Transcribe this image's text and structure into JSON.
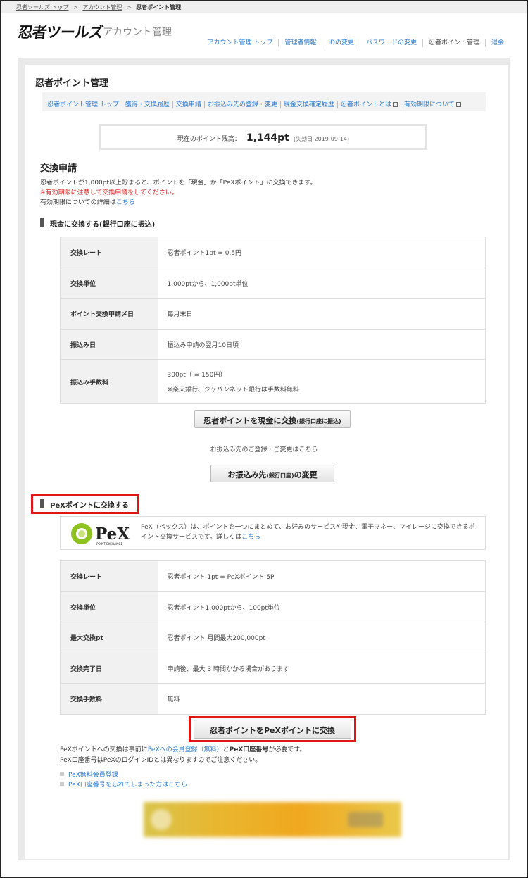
{
  "breadcrumb": {
    "items": [
      "忍者ツールズ トップ",
      "アカウント管理",
      "忍者ポイント管理"
    ],
    "separator": ">"
  },
  "header": {
    "logo": "忍者ツールズ",
    "subtitle": "アカウント管理",
    "nav": [
      "アカウント管理 トップ",
      "管理者情報",
      "IDの変更",
      "パスワードの変更",
      "忍者ポイント管理",
      "退会"
    ]
  },
  "page": {
    "title": "忍者ポイント管理",
    "subnav": [
      "忍者ポイント管理 トップ",
      "獲得・交換履歴",
      "交換申請",
      "お振込み先の登録・変更",
      "現金交換確定履歴",
      "忍者ポイントとは",
      "有効期限について"
    ]
  },
  "balance": {
    "label": "現在のポイント残高：",
    "value": "1,144pt",
    "expiry": "(失効日 2019-09-14)"
  },
  "exchange": {
    "title": "交換申請",
    "desc1": "忍者ポイントが1,000pt以上貯まると、ポイントを「現金」か「PeXポイント」に交換できます。",
    "warning": "※有効期限に注意して交換申請をしてください。",
    "desc3_prefix": "有効期限についての詳細は",
    "desc3_link": "こちら"
  },
  "cash": {
    "heading": "現金に交換する(銀行口座に振込)",
    "rows": [
      {
        "label": "交換レート",
        "value": "忍者ポイント1pt = 0.5円"
      },
      {
        "label": "交換単位",
        "value": "1,000ptから、1,000pt単位"
      },
      {
        "label": "ポイント交換申請〆日",
        "value": "毎月末日"
      },
      {
        "label": "振込み日",
        "value": "振込み申請の翌月10日頃"
      },
      {
        "label": "振込み手数料",
        "value": "300pt（ = 150円）",
        "note": "※楽天銀行、ジャパンネット銀行は手数料無料"
      }
    ],
    "button_main": "忍者ポイントを現金に交換",
    "button_small": "(銀行口座に振込)",
    "register_note": "お振込み先のご登録・ご変更はこちら",
    "change_main": "お振込み先",
    "change_small": "(銀行口座)",
    "change_suffix": "の変更"
  },
  "pex": {
    "heading": "PeXポイントに交換する",
    "logo_text": "PeX",
    "logo_tag": "POINT EXCHANGE",
    "intro": "PeX（ペックス）は、ポイントを一つにまとめて、お好みのサービスや現金、電子マネー、マイレージに交換できるポイント交換サービスです。詳しくは",
    "intro_link": "こちら",
    "rows": [
      {
        "label": "交換レート",
        "value": "忍者ポイント 1pt = PeXポイント 5P"
      },
      {
        "label": "交換単位",
        "value": "忍者ポイント1,000ptから、100pt単位"
      },
      {
        "label": "最大交換pt",
        "value": "忍者ポイント 月間最大200,000pt"
      },
      {
        "label": "交換完了日",
        "value": "申請後、最大 3 時間かかる場合があります"
      },
      {
        "label": "交換手数料",
        "value": "無料"
      }
    ],
    "button": "忍者ポイントをPeXポイントに交換",
    "note1_a": "PeXポイントへの交換は事前に",
    "note1_link": "PeXへの会員登録（無料）",
    "note1_b": "と",
    "note1_bold": "PeX口座番号",
    "note1_c": "が必要です。",
    "note2": "PeX口座番号はPeXのログインIDとは異なりますのでご注意ください。",
    "links": [
      "PeX無料会員登録",
      "PeX口座番号を忘れてしまった方はこちら"
    ]
  },
  "colors": {
    "link": "#2a7bd3",
    "highlight": "#e01616",
    "warning": "#e02020",
    "pex_green": "#8dc21f"
  }
}
